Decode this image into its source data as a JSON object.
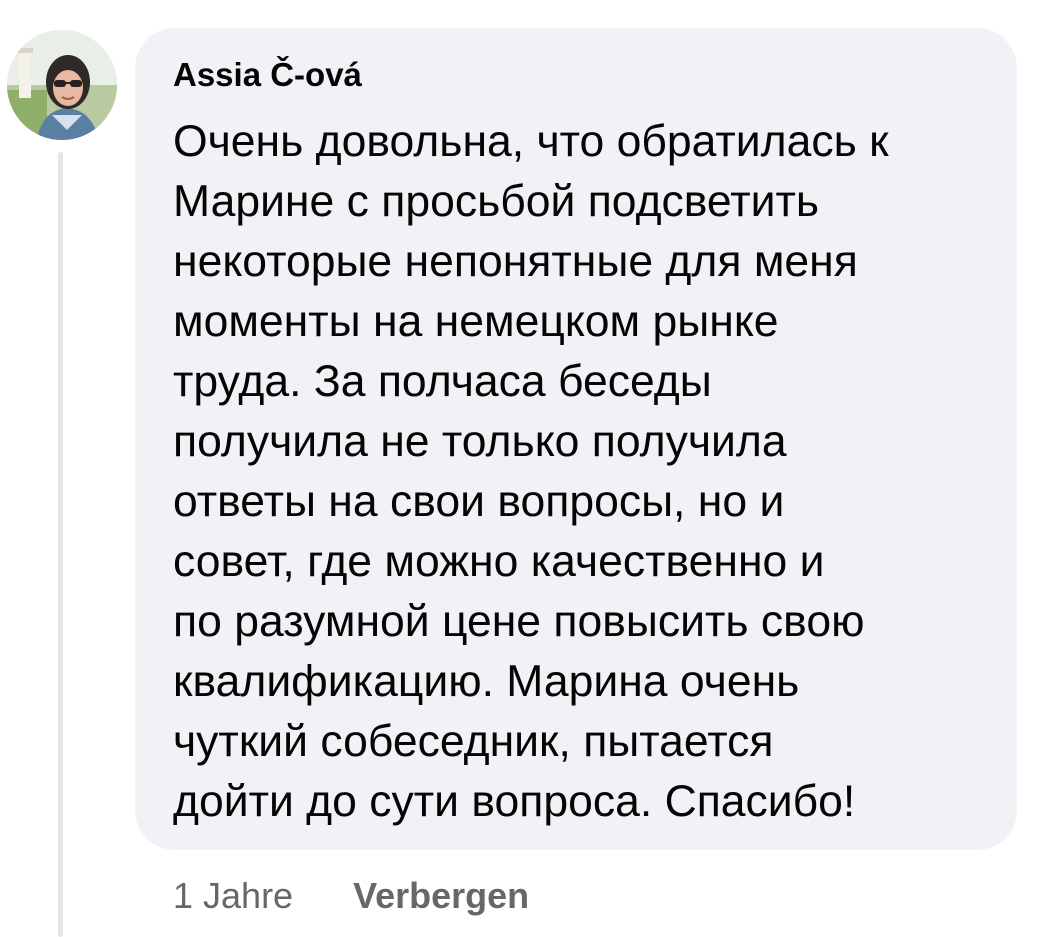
{
  "comment": {
    "author": "Assia Č-ová",
    "avatar_icon": "profile-photo",
    "lines": [
      "Очень довольна, что обратилась к",
      "Марине с просьбой подсветить",
      "некоторые непонятные для меня",
      "моменты на немецком рынке",
      "труда. За полчаса беседы",
      "получила не только получила",
      "ответы на свои вопросы, но и",
      "совет, где можно качественно и",
      "по разумной цене повысить свою",
      "квалификацию. Марина очень",
      "чуткий собеседник, пытается",
      "дойти до сути вопроса. Спасибо!"
    ],
    "time": "1 Jahre",
    "hide_label": "Verbergen"
  },
  "colors": {
    "bubble_bg": "#f0f2f5",
    "text": "#050505",
    "meta_text": "#65676b",
    "thread_line": "#e4e6eb"
  }
}
